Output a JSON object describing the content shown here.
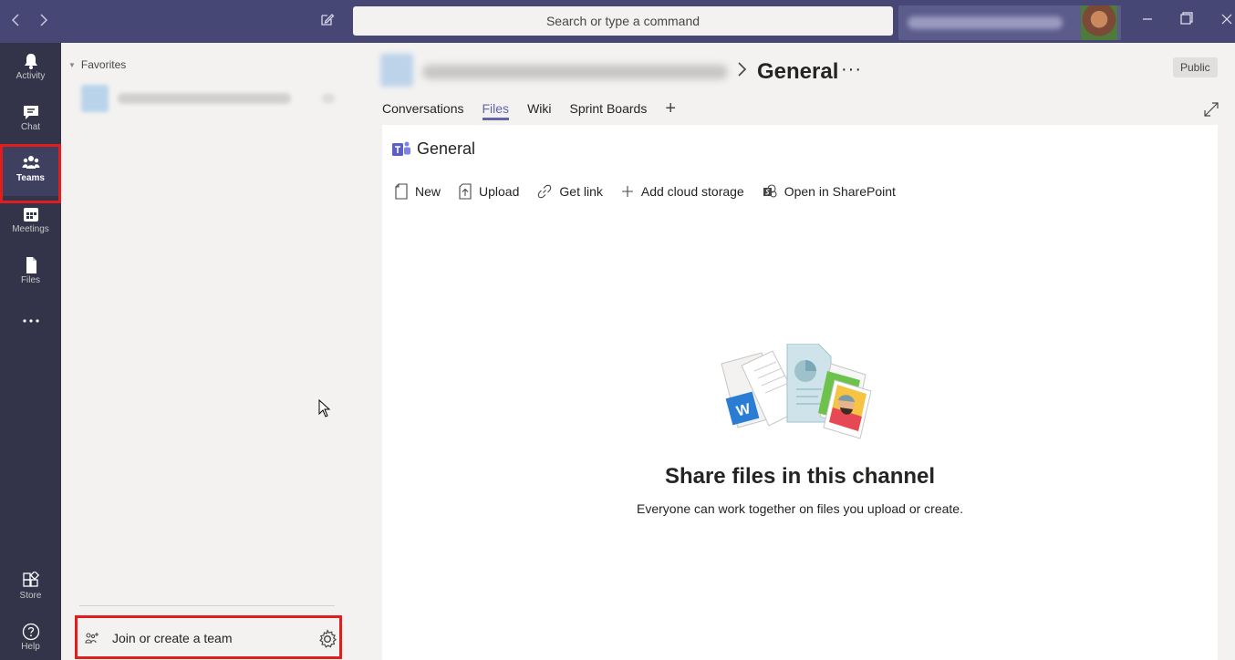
{
  "titlebar": {
    "search_placeholder": "Search or type a command",
    "back_icon": "chevron-left-icon",
    "forward_icon": "chevron-right-icon",
    "compose_icon": "compose-icon"
  },
  "rail": {
    "items": [
      {
        "label": "Activity",
        "icon": "bell-icon"
      },
      {
        "label": "Chat",
        "icon": "chat-icon"
      },
      {
        "label": "Teams",
        "icon": "teams-icon",
        "active": true
      },
      {
        "label": "Meetings",
        "icon": "calendar-icon"
      },
      {
        "label": "Files",
        "icon": "file-icon"
      },
      {
        "label": "...",
        "icon": "more-icon"
      }
    ],
    "bottom_items": [
      {
        "label": "Store",
        "icon": "store-icon"
      },
      {
        "label": "Help",
        "icon": "help-icon"
      }
    ]
  },
  "teams_panel": {
    "favorites_label": "Favorites",
    "join_label": "Join or create a team"
  },
  "channel": {
    "name": "General",
    "more": "···",
    "visibility": "Public",
    "tabs": [
      {
        "label": "Conversations",
        "active": false
      },
      {
        "label": "Files",
        "active": true
      },
      {
        "label": "Wiki",
        "active": false
      },
      {
        "label": "Sprint Boards",
        "active": false
      }
    ],
    "add_tab": "+"
  },
  "files": {
    "folder_title": "General",
    "toolbar": {
      "new": "New",
      "upload": "Upload",
      "get_link": "Get link",
      "add_cloud": "Add cloud storage",
      "open_sharepoint": "Open in SharePoint"
    },
    "empty_title": "Share files in this channel",
    "empty_subtitle": "Everyone can work together on files you upload or create."
  },
  "colors": {
    "brand": "#6264a7",
    "titlebar": "#464775",
    "rail": "#33344a",
    "highlight": "#e01e1e"
  }
}
